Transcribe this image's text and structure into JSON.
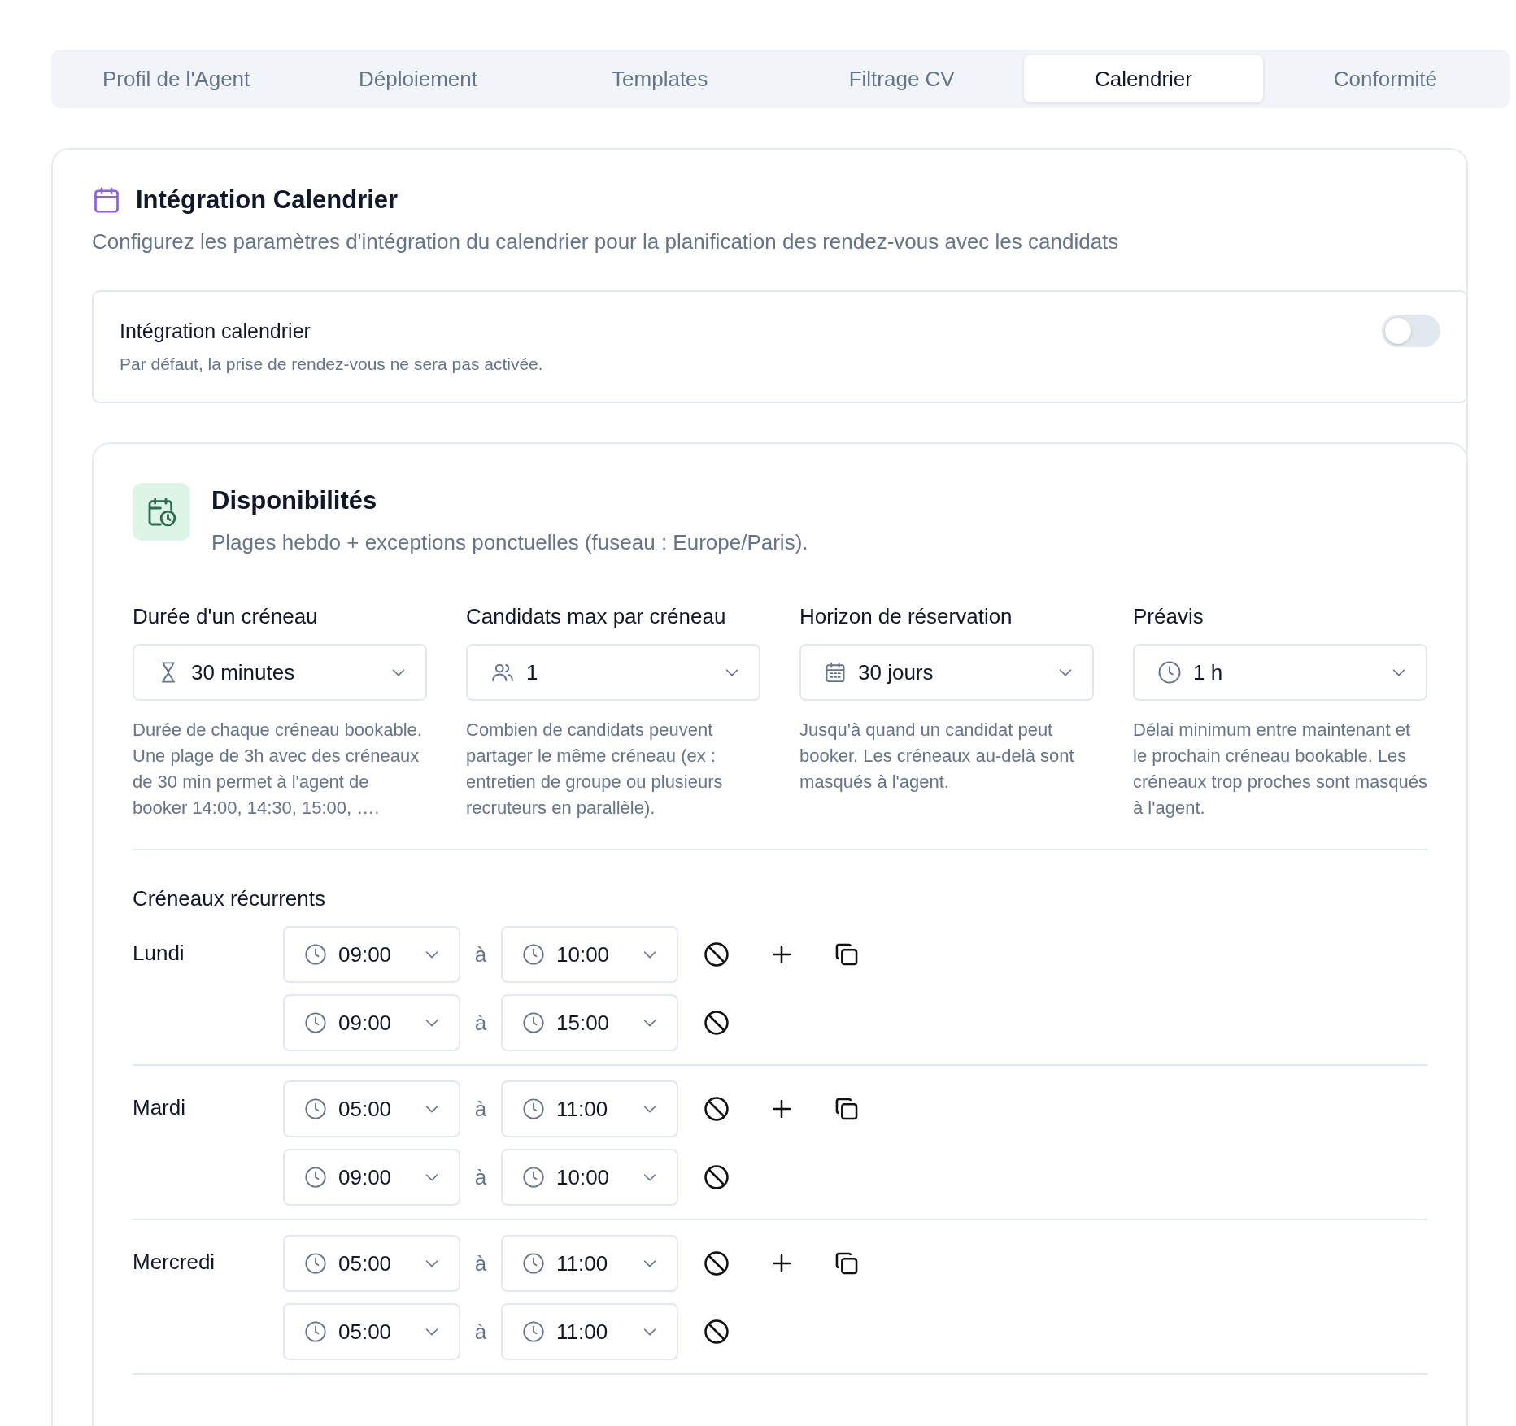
{
  "tabs": [
    {
      "label": "Profil de l'Agent",
      "selected": false
    },
    {
      "label": "Déploiement",
      "selected": false
    },
    {
      "label": "Templates",
      "selected": false
    },
    {
      "label": "Filtrage CV",
      "selected": false
    },
    {
      "label": "Calendrier",
      "selected": true
    },
    {
      "label": "Conformité",
      "selected": false
    }
  ],
  "section": {
    "title": "Intégration Calendrier",
    "description": "Configurez les paramètres d'intégration du calendrier pour la planification des rendez-vous avec les candidats"
  },
  "integration": {
    "label": "Intégration calendrier",
    "hint": "Par défaut, la prise de rendez-vous ne sera pas activée.",
    "on": false
  },
  "availability": {
    "title": "Disponibilités",
    "subtitle": "Plages hebdo + exceptions ponctuelles (fuseau : Europe/Paris).",
    "settings": [
      {
        "kind": "duration",
        "label": "Durée d'un créneau",
        "value": "30 minutes",
        "help": "Durée de chaque créneau bookable. Une plage de 3h avec des créneaux de 30 min permet à l'agent de booker 14:00, 14:30, 15:00, …."
      },
      {
        "kind": "people",
        "label": "Candidats max par créneau",
        "value": "1",
        "help": "Combien de candidats peuvent partager le même créneau (ex : entretien de groupe ou plusieurs recruteurs en parallèle)."
      },
      {
        "kind": "calendar",
        "label": "Horizon de réservation",
        "value": "30 jours",
        "help": "Jusqu'à quand un candidat peut booker. Les créneaux au-delà sont masqués à l'agent."
      },
      {
        "kind": "clock",
        "label": "Préavis",
        "value": "1 h",
        "help": "Délai minimum entre maintenant et le prochain créneau bookable. Les créneaux trop proches sont masqués à l'agent."
      }
    ],
    "recurring_title": "Créneaux récurrents",
    "days": [
      {
        "name": "Lundi",
        "slots": [
          {
            "start": "09:00",
            "separator": "à",
            "end": "10:00"
          },
          {
            "start": "09:00",
            "separator": "à",
            "end": "15:00"
          }
        ]
      },
      {
        "name": "Mardi",
        "slots": [
          {
            "start": "05:00",
            "separator": "à",
            "end": "11:00"
          },
          {
            "start": "09:00",
            "separator": "à",
            "end": "10:00"
          }
        ]
      },
      {
        "name": "Mercredi",
        "slots": [
          {
            "start": "05:00",
            "separator": "à",
            "end": "11:00"
          },
          {
            "start": "05:00",
            "separator": "à",
            "end": "11:00"
          }
        ]
      }
    ]
  }
}
